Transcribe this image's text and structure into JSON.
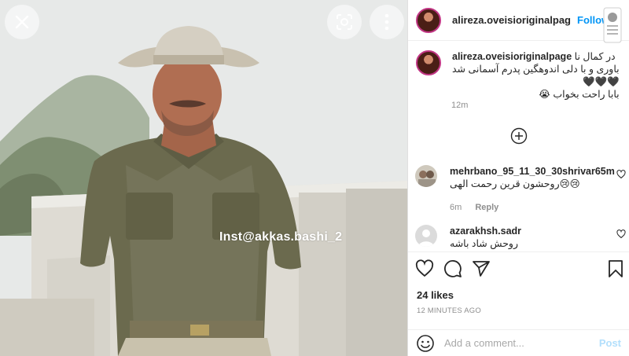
{
  "photo": {
    "watermark": "Inst@akkas.bashi_2",
    "buttons": {
      "close_icon": "close-icon",
      "lens_icon": "lens-search-icon",
      "more_icon": "more-vertical-icon"
    }
  },
  "header": {
    "username": "alireza.oveisioriginalpag",
    "follow_label": "Follow"
  },
  "caption": {
    "username": "alireza.oveisioriginalpage",
    "text_line1": "در کمال نا",
    "text_line2": "باوری و با دلی اندوهگین پدرم آسمانی شد",
    "text_line3": "🖤🖤🖤",
    "text_line4": "بابا راحت بخواب 😭",
    "time": "12m"
  },
  "comments": [
    {
      "username": "mehrbano_95_11_30_30shrivar65m",
      "text": "😢😢روحشون قرین رحمت الهی",
      "time": "6m",
      "reply_label": "Reply"
    },
    {
      "username": "azarakhsh.sadr",
      "text": "روحش شاد باشه"
    }
  ],
  "likes": "24 likes",
  "time_ago": "12 MINUTES AGO",
  "add_comment": {
    "placeholder": "Add a comment...",
    "post_label": "Post"
  },
  "colors": {
    "accent": "#0095f6",
    "post_disabled": "#b2dffc",
    "muted": "#8e8e8e",
    "text": "#262626"
  }
}
